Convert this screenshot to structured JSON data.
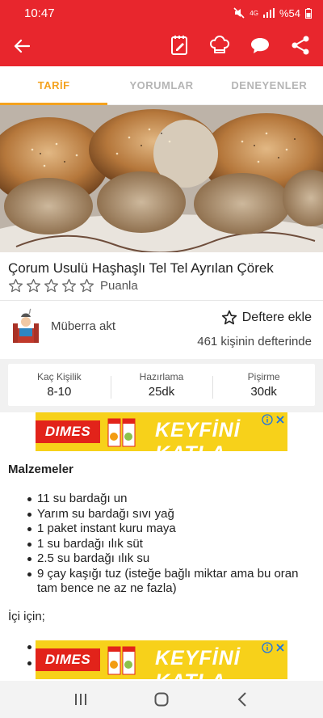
{
  "status": {
    "time": "10:47",
    "network": "4G",
    "battery": "%54"
  },
  "toolbar": {
    "back_icon": "arrow-left-icon",
    "actions": [
      "notes-icon",
      "chef-hat-icon",
      "comment-icon",
      "share-icon"
    ]
  },
  "tabs": [
    {
      "label": "TARİF",
      "active": true
    },
    {
      "label": "YORUMLAR",
      "active": false
    },
    {
      "label": "DENEYENLER",
      "active": false
    }
  ],
  "recipe": {
    "title": "Çorum Usulü Haşhaşlı Tel Tel Ayrılan Çörek",
    "rating_label": "Puanla",
    "stars": 0,
    "star_count": 5
  },
  "author": {
    "name": "Müberra akt",
    "add_label": "Deftere ekle",
    "saved_count": "461 kişinin defterinde"
  },
  "info": [
    {
      "label": "Kaç Kişilik",
      "value": "8-10"
    },
    {
      "label": "Hazırlama",
      "value": "25dk"
    },
    {
      "label": "Pişirme",
      "value": "30dk"
    }
  ],
  "ad": {
    "brand": "DIMES",
    "slogan": "KEYFİNİ KATLA",
    "color": "#f7d11a"
  },
  "ingredients": {
    "heading": "Malzemeler",
    "items": [
      "11 su bardağı un",
      "Yarım su bardağı sıvı yağ",
      "1 paket instant kuru maya",
      "1 su bardağı ılık süt",
      "2.5 su bardağı ılık su",
      "9 çay kaşığı tuz (isteğe bağlı miktar ama bu oran tam bence ne az ne fazla)"
    ],
    "filling_heading": "İçi için;"
  },
  "colors": {
    "primary": "#e8262d",
    "accent": "#f4a21e"
  }
}
